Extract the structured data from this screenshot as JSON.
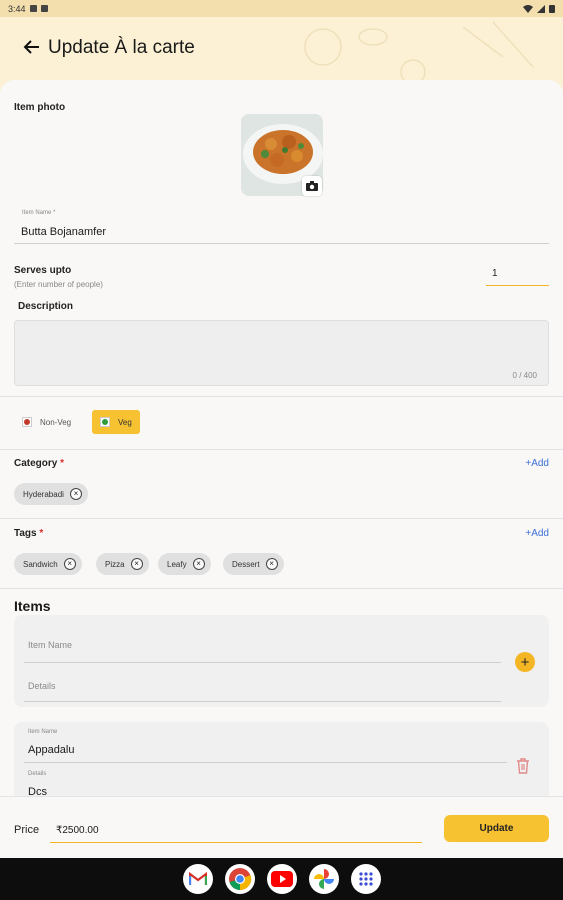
{
  "status": {
    "time": "3:44"
  },
  "header": {
    "title": "Update À la carte"
  },
  "photo": {
    "label": "Item photo"
  },
  "item_name": {
    "label": "Item Name *",
    "value": "Butta Bojanamfer"
  },
  "serves": {
    "label": "Serves upto",
    "hint": "(Enter number of people)",
    "value": "1"
  },
  "description": {
    "label": "Description",
    "counter": "0 / 400",
    "value": ""
  },
  "diet": {
    "non_veg": "Non-Veg",
    "veg": "Veg",
    "selected": "Veg"
  },
  "category": {
    "label": "Category",
    "required_mark": "*",
    "add": "+Add",
    "chips": [
      "Hyderabadi"
    ]
  },
  "tags": {
    "label": "Tags",
    "required_mark": "*",
    "add": "+Add",
    "chips": [
      "Sandwich",
      "Pizza",
      "Leafy",
      "Dessert"
    ]
  },
  "items": {
    "title": "Items",
    "new_item": {
      "name_placeholder": "Item Name",
      "details_placeholder": "Details"
    },
    "entries": [
      {
        "name_label": "Item Name",
        "name": "Appadalu",
        "details_label": "Details",
        "details": "Dcs"
      }
    ]
  },
  "footer": {
    "price_label": "Price",
    "price_value": "₹2500.00",
    "update_label": "Update"
  },
  "colors": {
    "accent": "#f7c231",
    "header_bg": "#fcf1d4",
    "link": "#3b6fd6",
    "required": "#d32f2f"
  },
  "nav_apps": [
    "gmail-icon",
    "chrome-icon",
    "youtube-icon",
    "photos-icon",
    "app-drawer-icon"
  ]
}
